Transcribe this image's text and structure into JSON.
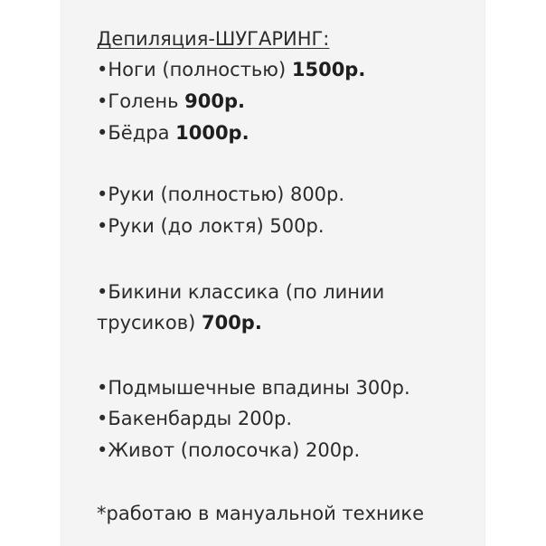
{
  "title": "Депиляция-ШУГАРИНГ:",
  "items": [
    {
      "text": "•Ноги (полностью) ",
      "price": "1500р."
    },
    {
      "text": "•Голень ",
      "price": "900р."
    },
    {
      "text": "•Бёдра ",
      "price": "1000р."
    },
    {
      "text": "•Руки (полностью) 800р."
    },
    {
      "text": "•Руки (до локтя) 500р."
    },
    {
      "text": "•Бикини классика (по линии"
    },
    {
      "text": "трусиков) ",
      "price": "700р."
    },
    {
      "text": "•Подмышечные впадины 300р."
    },
    {
      "text": "•Бакенбарды 200р."
    },
    {
      "text": "•Живот (полосочка) 200р."
    }
  ],
  "footnote": "*работаю в мануальной технике"
}
